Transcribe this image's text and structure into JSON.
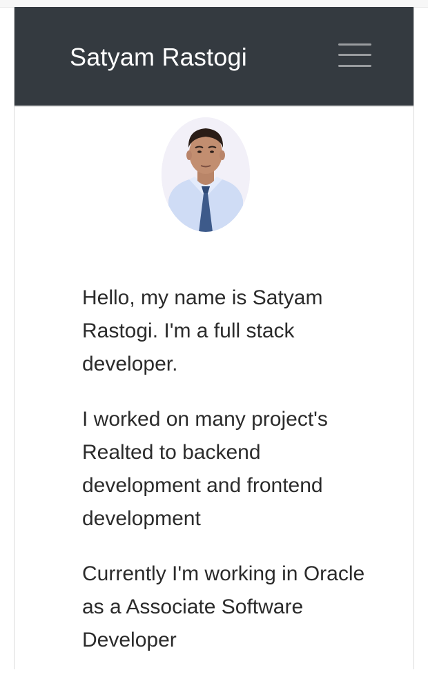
{
  "navbar": {
    "brand": "Satyam Rastogi",
    "toggler_icon": "hamburger-menu-icon"
  },
  "profile": {
    "avatar_alt": "profile-photo"
  },
  "about": {
    "paragraphs": [
      "Hello, my name is Satyam Rastogi. I'm a full stack developer.",
      "I worked on many project's Realted to backend development and frontend development",
      "Currently I'm working in Oracle as a Associate Software Developer"
    ]
  },
  "colors": {
    "navbar_bg": "#343a40",
    "brand_text": "#ffffff",
    "body_text": "#2b2b2b"
  }
}
